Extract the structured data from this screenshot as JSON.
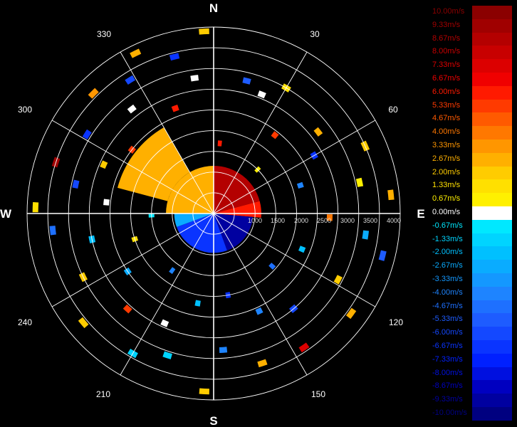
{
  "chart_data": {
    "type": "heatmap",
    "subtype": "polar radial-velocity scan",
    "compass": [
      "N",
      "E",
      "S",
      "W"
    ],
    "azimuth_labels": [
      "30",
      "60",
      "120",
      "150",
      "210",
      "240",
      "300",
      "330"
    ],
    "range_labels": [
      "1000",
      "1500",
      "2000",
      "2500",
      "3000",
      "3500",
      "4000"
    ],
    "range_max": 4500,
    "ring_step": 500,
    "grid": true,
    "legend_placement": "right",
    "colorbar": {
      "unit": "m/s",
      "min": -10.0,
      "max": 10.0,
      "labels": [
        "10.00m/s",
        "9.33m/s",
        "8.67m/s",
        "8.00m/s",
        "7.33m/s",
        "6.67m/s",
        "6.00m/s",
        "5.33m/s",
        "4.67m/s",
        "4.00m/s",
        "3.33m/s",
        "2.67m/s",
        "2.00m/s",
        "1.33m/s",
        "0.67m/s",
        "0.00m/s",
        "-0.67m/s",
        "-1.33m/s",
        "-2.00m/s",
        "-2.67m/s",
        "-3.33m/s",
        "-4.00m/s",
        "-4.67m/s",
        "-5.33m/s",
        "-6.00m/s",
        "-6.67m/s",
        "-7.33m/s",
        "-8.00m/s",
        "-8.67m/s",
        "-9.33m/s",
        "-10.00m/s"
      ],
      "colors": [
        "#8b0000",
        "#a00000",
        "#b40000",
        "#c80000",
        "#dc0000",
        "#f00000",
        "#ff1a00",
        "#ff3a00",
        "#ff5a00",
        "#ff7800",
        "#ff9600",
        "#ffb000",
        "#ffcc00",
        "#ffe000",
        "#fff000",
        "#ffffff",
        "#00e8ff",
        "#00d4ff",
        "#00c0ff",
        "#0aacff",
        "#1498ff",
        "#1e84ff",
        "#1e70ff",
        "#1e5cff",
        "#1448ff",
        "#0a34ff",
        "#0020ff",
        "#0010e0",
        "#0000c0",
        "#0000a0",
        "#000080"
      ]
    },
    "velocity_field": [
      {
        "az_from": 0,
        "az_to": 75,
        "range_from": 0,
        "range_to": 1150,
        "velocity": 9.0,
        "note": "north-east near field, strong positive"
      },
      {
        "az_from": 75,
        "az_to": 95,
        "range_from": 0,
        "range_to": 1150,
        "velocity": 6.0
      },
      {
        "az_from": 270,
        "az_to": 360,
        "range_from": 0,
        "range_to": 1150,
        "velocity": 3.0
      },
      {
        "az_from": 95,
        "az_to": 160,
        "range_from": 0,
        "range_to": 950,
        "velocity": -9.0
      },
      {
        "az_from": 160,
        "az_to": 250,
        "range_from": 0,
        "range_to": 950,
        "velocity": -6.5
      },
      {
        "az_from": 250,
        "az_to": 270,
        "range_from": 0,
        "range_to": 950,
        "velocity": -2.5
      },
      {
        "az_from": 285,
        "az_to": 330,
        "range_from": 1150,
        "range_to": 2400,
        "velocity": 2.5,
        "note": "north-west extended echo"
      }
    ],
    "scatter_gates": [
      {
        "az": 5,
        "r": 1700,
        "v": 6.0
      },
      {
        "az": 14,
        "r": 3300,
        "v": -5.3
      },
      {
        "az": 22,
        "r": 3100,
        "v": 0.0
      },
      {
        "az": 30,
        "r": 3500,
        "v": 1.3
      },
      {
        "az": 38,
        "r": 2400,
        "v": 5.3
      },
      {
        "az": 45,
        "r": 1500,
        "v": 0.7
      },
      {
        "az": 52,
        "r": 3200,
        "v": 2.7
      },
      {
        "az": 60,
        "r": 2800,
        "v": -6.7
      },
      {
        "az": 66,
        "r": 4000,
        "v": 2.0
      },
      {
        "az": 72,
        "r": 2200,
        "v": -4.0
      },
      {
        "az": 78,
        "r": 3600,
        "v": 0.7
      },
      {
        "az": 84,
        "r": 4300,
        "v": 2.7
      },
      {
        "az": 92,
        "r": 2800,
        "v": 4.0
      },
      {
        "az": 98,
        "r": 3700,
        "v": -2.7
      },
      {
        "az": 104,
        "r": 4200,
        "v": -5.3
      },
      {
        "az": 112,
        "r": 2300,
        "v": -2.0
      },
      {
        "az": 118,
        "r": 3400,
        "v": 2.0
      },
      {
        "az": 126,
        "r": 4100,
        "v": 2.7
      },
      {
        "az": 132,
        "r": 1900,
        "v": -4.7
      },
      {
        "az": 140,
        "r": 3000,
        "v": -6.0
      },
      {
        "az": 146,
        "r": 3900,
        "v": 7.3
      },
      {
        "az": 155,
        "r": 2600,
        "v": -4.0
      },
      {
        "az": 162,
        "r": 3800,
        "v": 2.7
      },
      {
        "az": 170,
        "r": 2000,
        "v": -6.7
      },
      {
        "az": 176,
        "r": 3300,
        "v": -4.0
      },
      {
        "az": 183,
        "r": 4300,
        "v": 2.0
      },
      {
        "az": 190,
        "r": 2200,
        "v": -2.0
      },
      {
        "az": 198,
        "r": 3600,
        "v": -1.3
      },
      {
        "az": 204,
        "r": 2900,
        "v": 0.0
      },
      {
        "az": 210,
        "r": 3900,
        "v": -1.3
      },
      {
        "az": 216,
        "r": 1700,
        "v": -4.0
      },
      {
        "az": 222,
        "r": 3100,
        "v": 5.3
      },
      {
        "az": 230,
        "r": 4100,
        "v": 2.0
      },
      {
        "az": 236,
        "r": 2500,
        "v": -2.7
      },
      {
        "az": 244,
        "r": 3500,
        "v": 2.0
      },
      {
        "az": 252,
        "r": 2000,
        "v": 1.3
      },
      {
        "az": 258,
        "r": 3000,
        "v": -2.0
      },
      {
        "az": 264,
        "r": 3900,
        "v": -4.7
      },
      {
        "az": 268,
        "r": 1500,
        "v": -0.7
      },
      {
        "az": 272,
        "r": 4300,
        "v": 1.3
      },
      {
        "az": 276,
        "r": 2600,
        "v": 0.0
      },
      {
        "az": 282,
        "r": 3400,
        "v": -6.0
      },
      {
        "az": 288,
        "r": 4000,
        "v": 9.3
      },
      {
        "az": 294,
        "r": 2900,
        "v": 2.0
      },
      {
        "az": 302,
        "r": 3600,
        "v": -6.7
      },
      {
        "az": 308,
        "r": 2500,
        "v": 5.3
      },
      {
        "az": 315,
        "r": 4100,
        "v": 3.3
      },
      {
        "az": 322,
        "r": 3200,
        "v": 0.0
      },
      {
        "az": 328,
        "r": 3800,
        "v": -6.0
      },
      {
        "az": 334,
        "r": 4300,
        "v": 2.7
      },
      {
        "az": 340,
        "r": 2700,
        "v": 6.0
      },
      {
        "az": 346,
        "r": 3900,
        "v": -6.7
      },
      {
        "az": 352,
        "r": 3300,
        "v": 0.0
      },
      {
        "az": 357,
        "r": 4400,
        "v": 2.0
      }
    ]
  }
}
